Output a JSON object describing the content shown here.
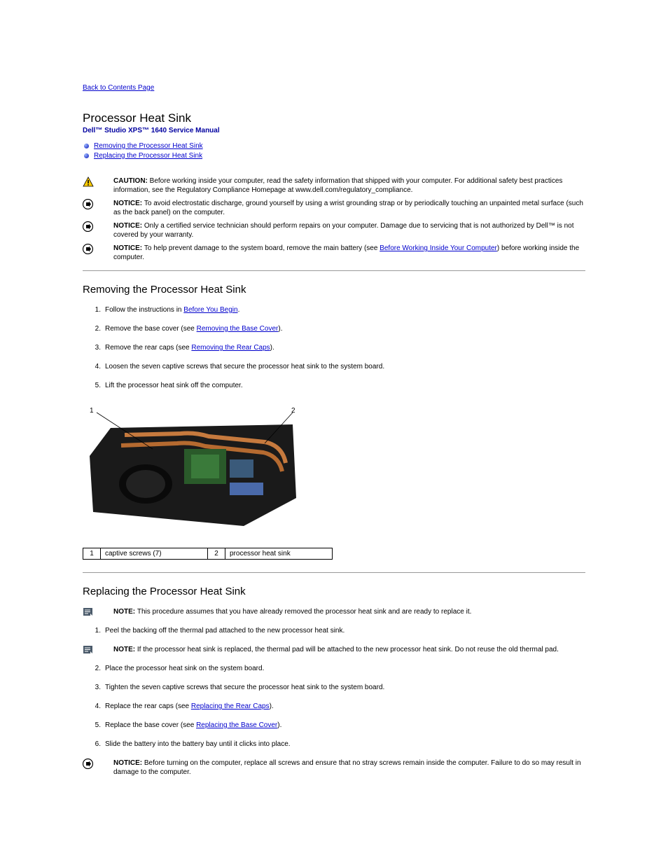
{
  "nav": {
    "back": "Back to Contents Page"
  },
  "header": {
    "section_title": "Processor Heat Sink",
    "manual_title": "Dell™ Studio XPS™ 1640 Service Manual"
  },
  "toc": {
    "item1": "Removing the Processor Heat Sink",
    "item2": "Replacing the Processor Heat Sink"
  },
  "notices": {
    "caution_label": "CAUTION: ",
    "caution_text": "Before working inside your computer, read the safety information that shipped with your computer. For additional safety best practices information, see the Regulatory Compliance Homepage at www.dell.com/regulatory_compliance.",
    "notice1_label": "NOTICE: ",
    "notice1_text": "To avoid electrostatic discharge, ground yourself by using a wrist grounding strap or by periodically touching an unpainted metal surface (such as the back panel) on the computer.",
    "notice2_label": "NOTICE: ",
    "notice2_text": "Only a certified service technician should perform repairs on your computer. Damage due to servicing that is not authorized by Dell™ is not covered by your warranty.",
    "notice3_label": "NOTICE: ",
    "notice3_pre": "To help prevent damage to the system board, remove the main battery (see ",
    "notice3_link": "Before Working Inside Your Computer",
    "notice3_post": ") before working inside the computer."
  },
  "remove": {
    "heading": "Removing the Processor Heat Sink",
    "step1_pre": "Follow the instructions in ",
    "step1_link": "Before You Begin",
    "step1_post": ".",
    "step2_pre": "Remove the base cover (see ",
    "step2_link": "Removing the Base Cover",
    "step2_post": ").",
    "step3_pre": "Remove the rear caps (see ",
    "step3_link": "Removing the Rear Caps",
    "step3_post": ").",
    "step4": "Loosen the seven captive screws that secure the processor heat sink to the system board.",
    "step5": "Lift the processor heat sink off the computer."
  },
  "callouts": {
    "c1": "1",
    "c2": "2"
  },
  "legend": {
    "n1": "1",
    "l1": "captive screws (7)",
    "n2": "2",
    "l2": "processor heat sink"
  },
  "replace": {
    "heading": "Replacing the Processor Heat Sink",
    "note1_label": "NOTE: ",
    "note1_text": "This procedure assumes that you have already removed the processor heat sink and are ready to replace it.",
    "step1": "Peel the backing off the thermal pad attached to the new processor heat sink.",
    "note2_label": "NOTE: ",
    "note2_text": "If the processor heat sink is replaced, the thermal pad will be attached to the new processor heat sink. Do not reuse the old thermal pad.",
    "step2": "Place the processor heat sink on the system board.",
    "step3": "Tighten the seven captive screws that secure the processor heat sink to the system board.",
    "step4_pre": "Replace the rear caps (see ",
    "step4_link": "Replacing the Rear Caps",
    "step4_post": ").",
    "step5_pre": "Replace the base cover (see ",
    "step5_link": "Replacing the Base Cover",
    "step5_post": ").",
    "step6": "Slide the battery into the battery bay until it clicks into place.",
    "notice_label": "NOTICE: ",
    "notice_text": "Before turning on the computer, replace all screws and ensure that no stray screws remain inside the computer. Failure to do so may result in damage to the computer."
  }
}
